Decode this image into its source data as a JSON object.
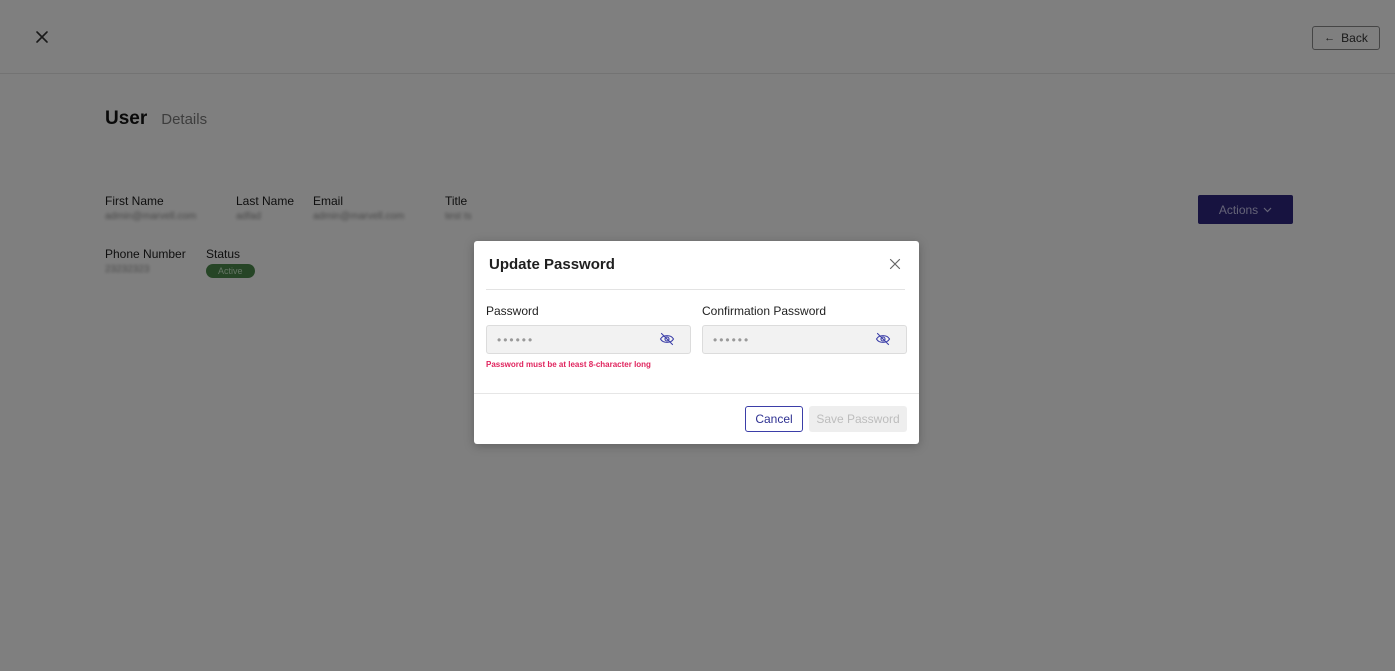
{
  "header": {
    "back_label": "Back"
  },
  "user": {
    "title": "User",
    "subtitle": "Details",
    "fields": {
      "first_name": {
        "label": "First Name",
        "value": "admin@marvell.com"
      },
      "last_name": {
        "label": "Last Name",
        "value": "adfad"
      },
      "email": {
        "label": "Email",
        "value": "admin@marvell.com"
      },
      "title": {
        "label": "Title",
        "value": "test ts"
      },
      "phone": {
        "label": "Phone Number",
        "value": "23232323"
      },
      "status": {
        "label": "Status",
        "value": "Active"
      }
    },
    "actions_label": "Actions"
  },
  "modal": {
    "title": "Update Password",
    "password_label": "Password",
    "password_value": "••••••",
    "confirm_label": "Confirmation Password",
    "confirm_value": "••••••",
    "error": "Password must be at least 8-character long",
    "cancel_label": "Cancel",
    "save_label": "Save Password"
  },
  "colors": {
    "accent": "#2f2680",
    "error": "#e0245e",
    "status": "#4d8a4d"
  },
  "icons": [
    "close-icon",
    "arrow-left-icon",
    "chevron-down-icon",
    "eye-off-icon"
  ]
}
